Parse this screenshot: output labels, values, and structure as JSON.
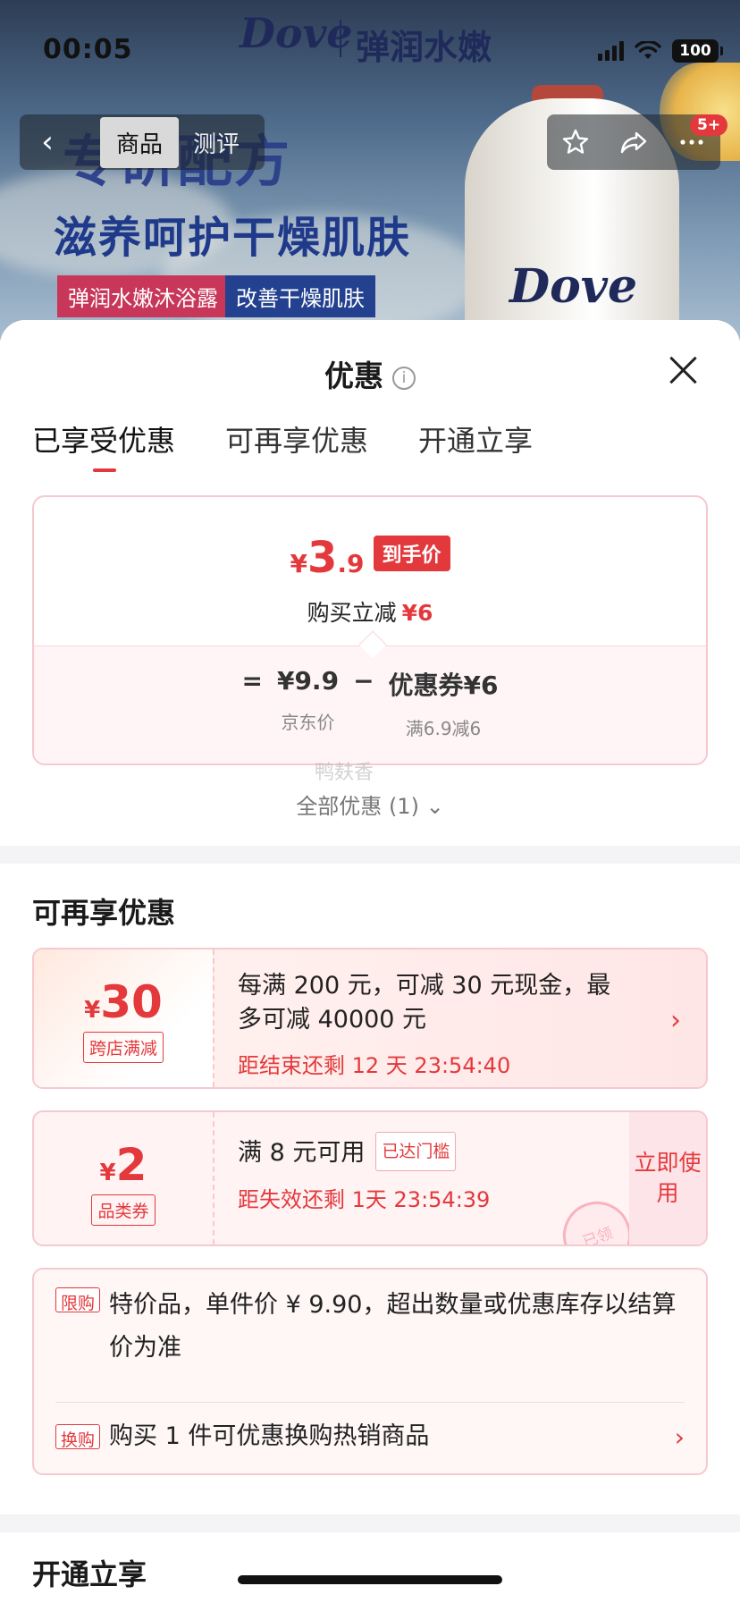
{
  "status": {
    "time": "00:05",
    "battery": "100"
  },
  "brand": {
    "logo": "Dove",
    "subtitle": "弹润水嫩"
  },
  "nav": {
    "tab_product": "商品",
    "tab_review": "测评",
    "badge": "5+"
  },
  "ad": {
    "headline": "专研配方",
    "tagline": "滋养呵护干燥肌肤",
    "tag1": "弹润水嫩沐浴露",
    "tag2": "改善干燥肌肤",
    "bottle_logo": "Dove"
  },
  "sheet": {
    "title": "优惠",
    "tabs": [
      "已享受优惠",
      "可再享优惠",
      "开通立享"
    ],
    "price": {
      "currency": "¥",
      "integer": "3",
      "decimal": ".9",
      "final_label": "到手价",
      "saving_text": "购买立减",
      "saving_value": "¥6"
    },
    "formula": {
      "eq": "=",
      "jd_price": "¥9.9",
      "jd_label": "京东价",
      "minus": "−",
      "coupon": "优惠券¥6",
      "coupon_rule": "满6.9减6"
    },
    "watermark": "鸭麸香",
    "all_offers": "全部优惠 (1)"
  },
  "more_offers": {
    "title": "可再享优惠",
    "coupons": [
      {
        "currency": "¥",
        "amount": "30",
        "tag": "跨店满减",
        "desc": "每满 200 元，可减 30 元现金，最多可减 40000 元",
        "countdown": "距结束还剩 12 天 23:54:40"
      },
      {
        "currency": "¥",
        "amount": "2",
        "tag": "品类券",
        "desc": "满 8 元可用",
        "reached": "已达门槛",
        "countdown": "距失效还剩 1天 23:54:39",
        "action": "立即使用",
        "stamp": "已领"
      }
    ],
    "limits": [
      {
        "tag": "限购",
        "text": "特价品，单件价 ¥ 9.90，超出数量或优惠库存以结算价为准"
      },
      {
        "tag": "换购",
        "text": "购买 1 件可优惠换购热销商品"
      }
    ]
  },
  "section3_title": "开通立享",
  "colors": {
    "accent": "#e4393c",
    "border": "#f5c9cf"
  }
}
